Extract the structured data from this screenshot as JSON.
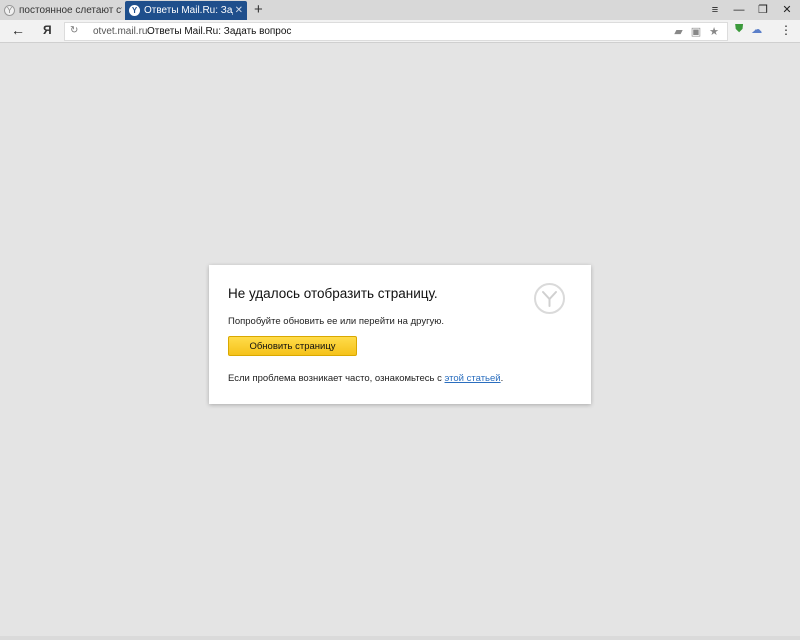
{
  "tabs": [
    {
      "title": "постоянное слетают страни",
      "favicon": "yandex-y-icon",
      "active": false
    },
    {
      "title": "Ответы Mail.Ru: Задать в",
      "favicon": "yandex-y-icon",
      "active": true,
      "close": "✕"
    }
  ],
  "new_tab_label": "+",
  "window_controls": {
    "menu": "≡",
    "minimize": "—",
    "restore": "❐",
    "close": "✕"
  },
  "toolbar": {
    "back_glyph": "←",
    "yandex_button": "Я",
    "reload_glyph": "↻",
    "url_domain": "otvet.mail.ru",
    "url_title": "Ответы Mail.Ru: Задать вопрос",
    "icons": [
      "protect-icon",
      "bookmarks-icon",
      "star-icon"
    ],
    "extensions": [
      "shield-extension-icon",
      "cloud-extension-icon"
    ]
  },
  "error_card": {
    "title": "Не удалось отобразить страницу.",
    "description": "Попробуйте обновить ее или перейти на другую.",
    "refresh_button": "Обновить страницу",
    "note_prefix": "Если проблема возникает часто, ознакомьтесь с ",
    "note_link": "этой статьей",
    "note_suffix": "."
  },
  "colors": {
    "active_tab": "#1f4f8c",
    "button_yellow": "#f5c21a",
    "link": "#2a6ebf",
    "page_bg": "#e4e4e4"
  }
}
